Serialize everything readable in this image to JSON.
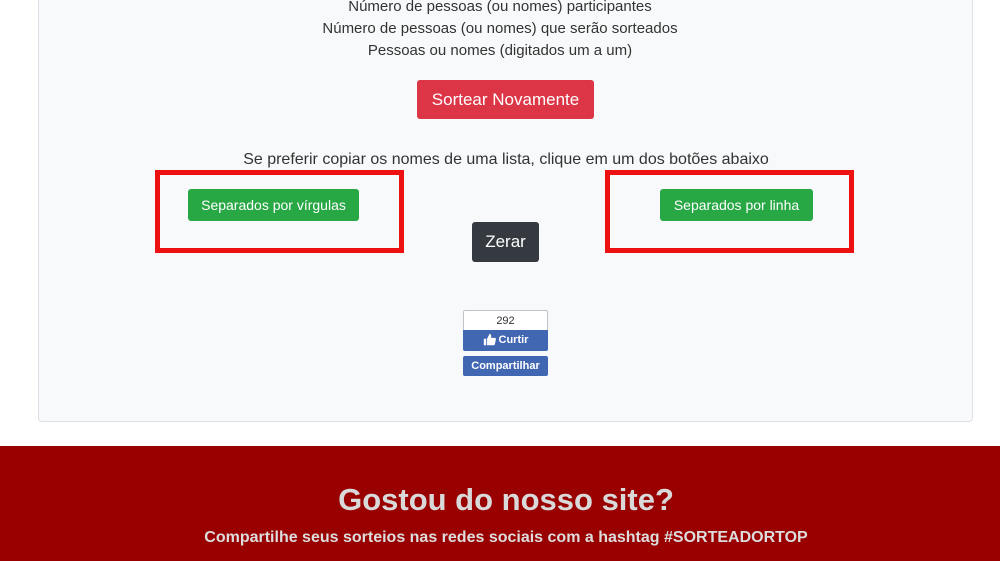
{
  "info": {
    "lines": [
      "Número de pessoas (ou nomes) participantes",
      "Número de pessoas (ou nomes) que serão sorteados",
      "Pessoas ou nomes (digitados um a um)"
    ]
  },
  "actions": {
    "sortear_label": "Sortear Novamente",
    "instruction": "Se preferir copiar os nomes de uma lista, clique em um dos botões abaixo",
    "virgulas_label": "Separados por vírgulas",
    "linha_label": "Separados por linha",
    "zerar_label": "Zerar"
  },
  "facebook": {
    "count": "292",
    "like_label": "Curtir",
    "share_label": "Compartilhar",
    "icon": "thumbs-up-icon"
  },
  "footer": {
    "title": "Gostou do nosso site?",
    "subtitle": "Compartilhe seus sorteios nas redes sociais com a hashtag #SORTEADORTOP"
  },
  "colors": {
    "danger": "#dc3545",
    "success": "#28a745",
    "dark": "#343a40",
    "facebook": "#4267b2",
    "footer_bg": "#990000",
    "highlight": "#ee1111"
  }
}
